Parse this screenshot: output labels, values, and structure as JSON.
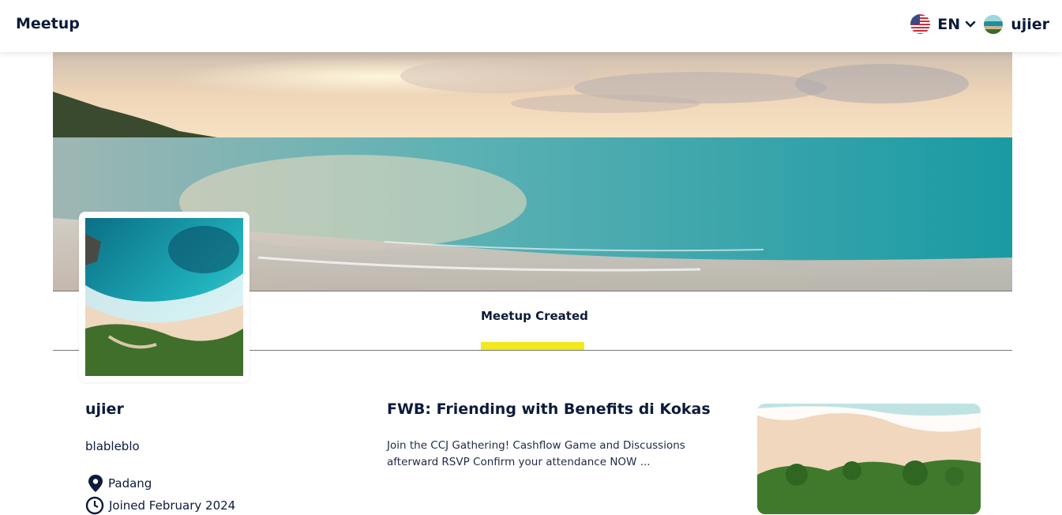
{
  "header": {
    "brand": "Meetup",
    "language": "EN",
    "username": "ujier",
    "icons": [
      "us-flag-icon",
      "chevron-down-icon",
      "avatar"
    ]
  },
  "tabs": [
    {
      "label": "Meetup Created",
      "active": true
    }
  ],
  "profile": {
    "name": "ujier",
    "bio": "blableblo",
    "location": "Padang",
    "joined": "Joined February 2024"
  },
  "meetup": {
    "title": "FWB: Friending with Benefits di Kokas",
    "description": "Join the CCJ Gathering! Cashflow Game and Discussions afterward RSVP Confirm your attendance NOW ..."
  },
  "colors": {
    "accent": "#f2e81c",
    "text": "#0b1b3a"
  }
}
